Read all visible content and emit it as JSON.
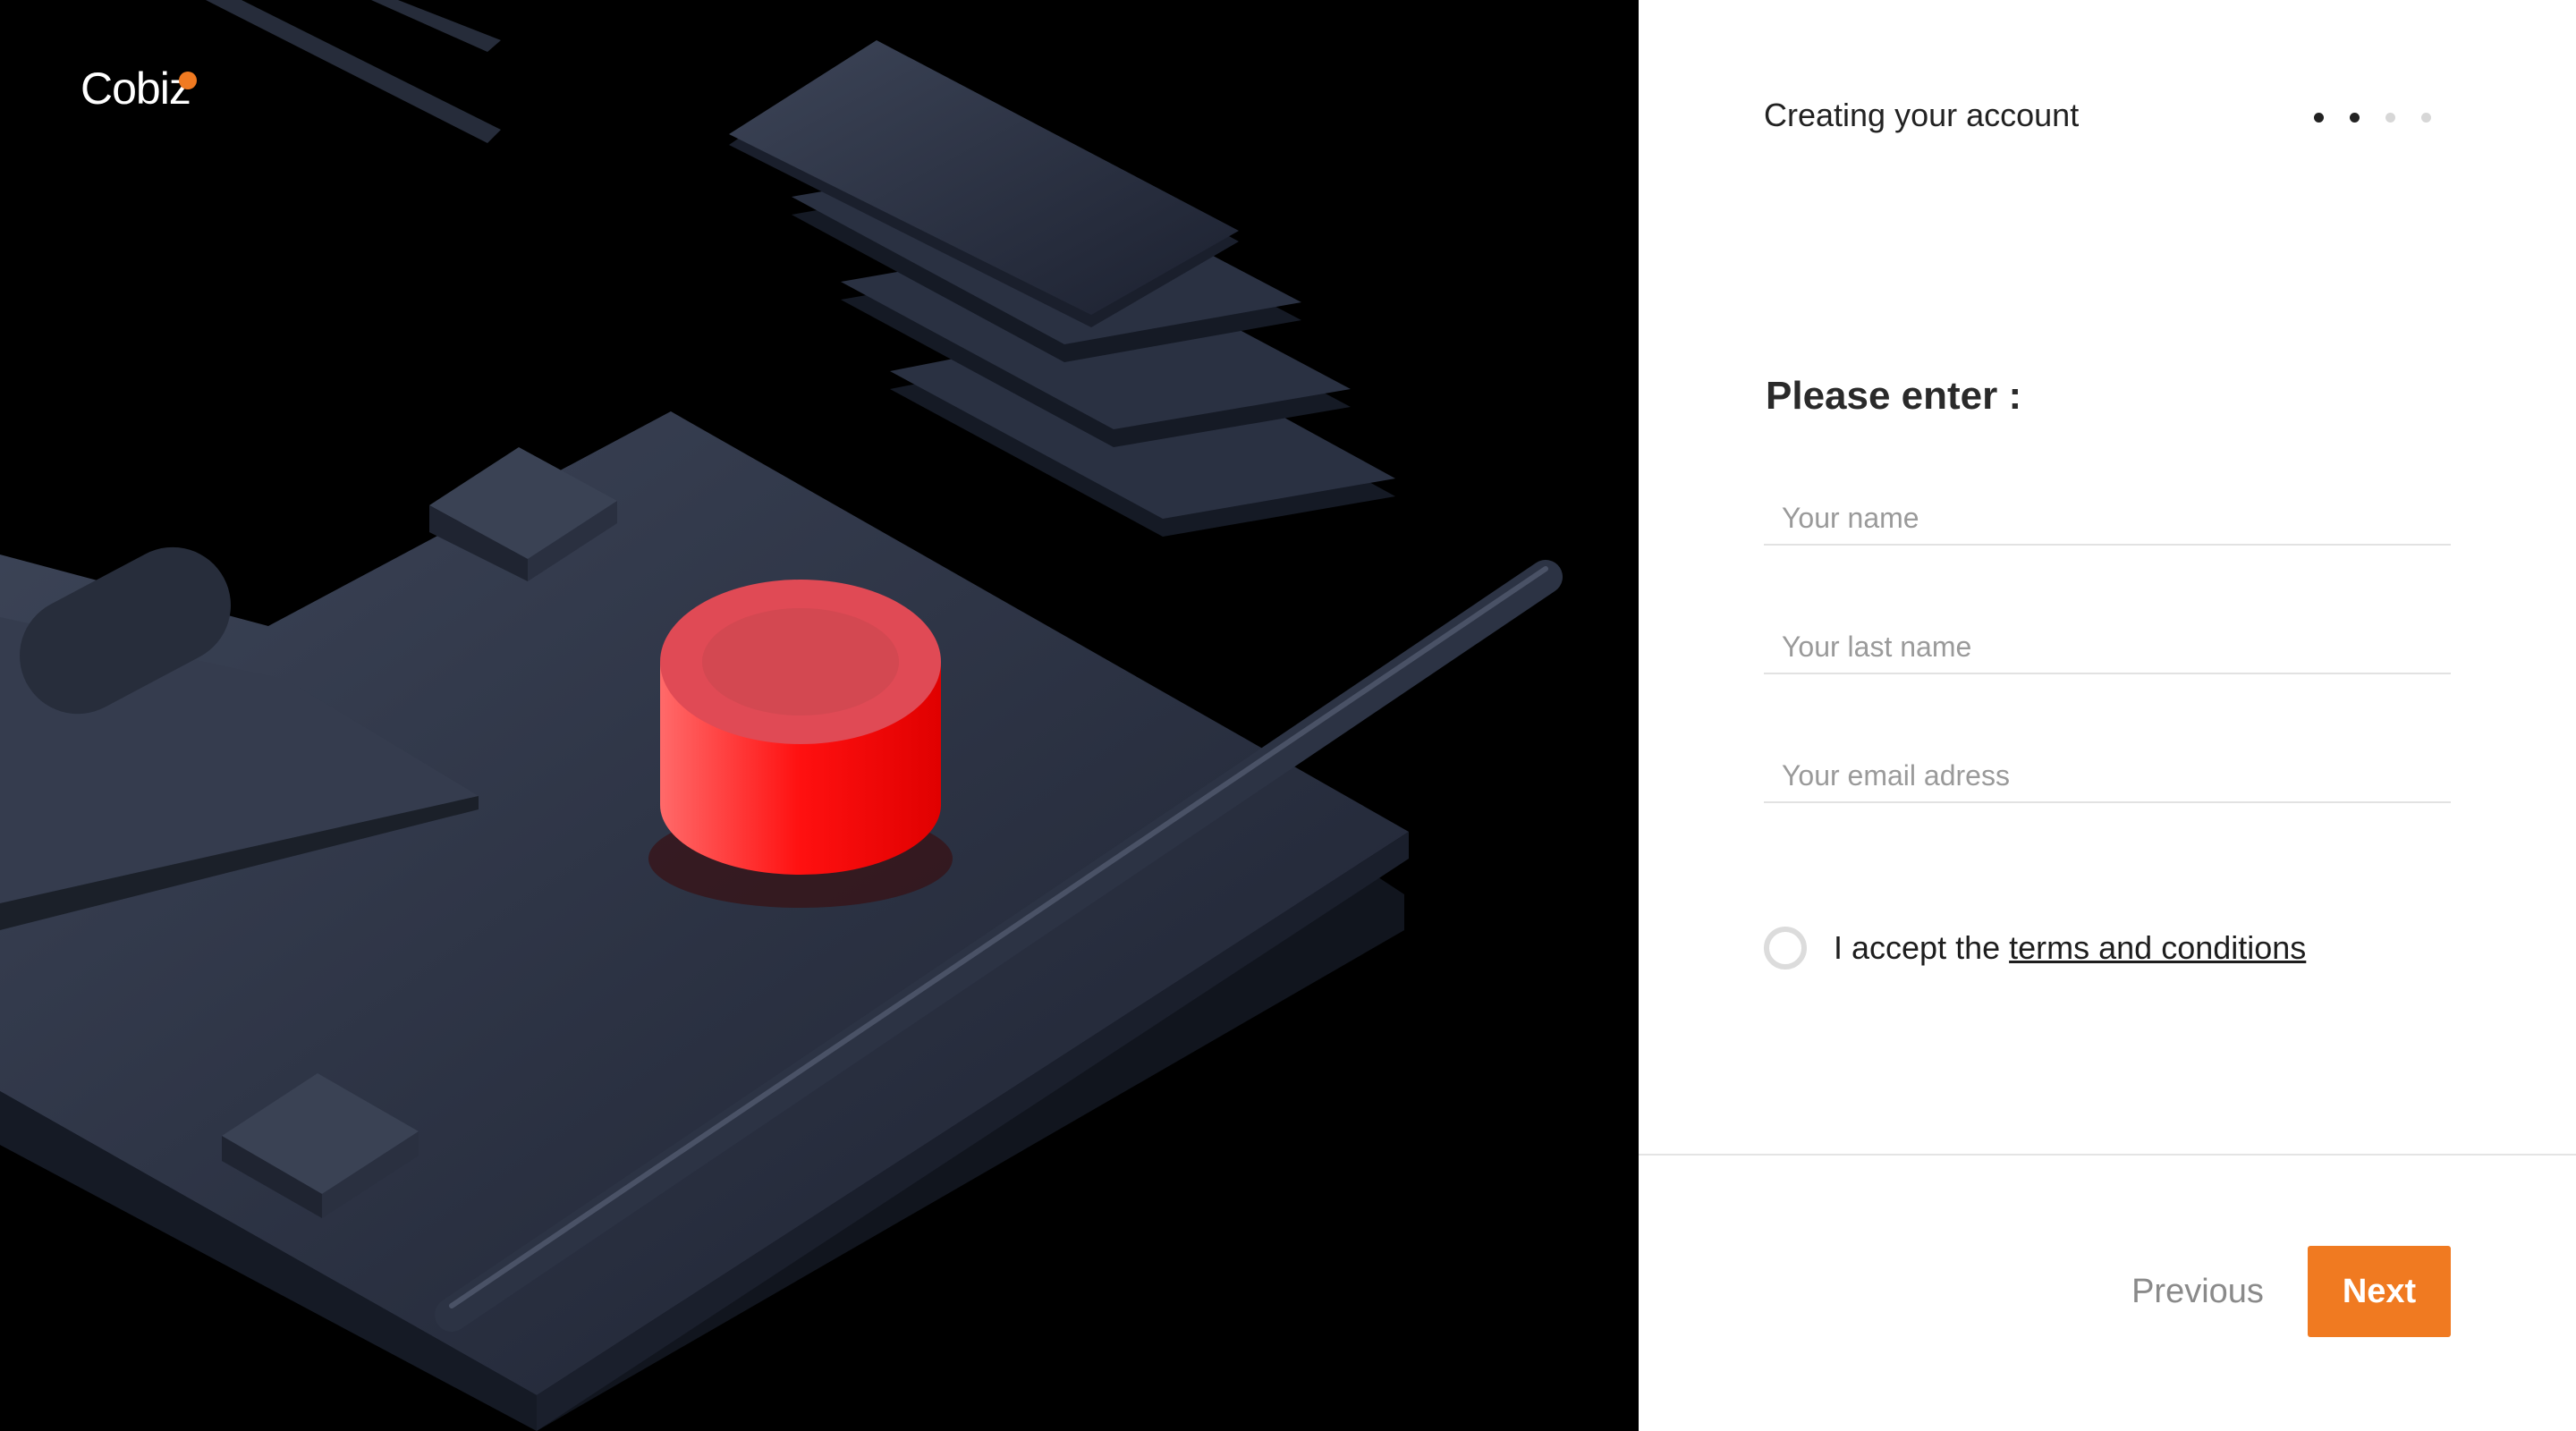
{
  "brand": {
    "name": "Cobiz"
  },
  "wizard": {
    "title": "Creating your account",
    "steps": [
      {
        "state": "complete"
      },
      {
        "state": "active"
      },
      {
        "state": "pending"
      },
      {
        "state": "pending"
      }
    ]
  },
  "form": {
    "heading": "Please enter :",
    "fields": {
      "first_name": {
        "placeholder": "Your name",
        "value": ""
      },
      "last_name": {
        "placeholder": "Your last name",
        "value": ""
      },
      "email": {
        "placeholder": "Your email adress",
        "value": ""
      }
    },
    "terms": {
      "prefix": "I accept the",
      "link_text": "terms and conditions",
      "checked": false
    }
  },
  "footer": {
    "previous_label": "Previous",
    "next_label": "Next"
  },
  "colors": {
    "accent": "#f07a21",
    "hero_background": "#000000",
    "hero_object": "#2a3142",
    "hero_cylinder": "#ff0f0f"
  },
  "icons": {
    "logo_mark": "orange-dot"
  }
}
